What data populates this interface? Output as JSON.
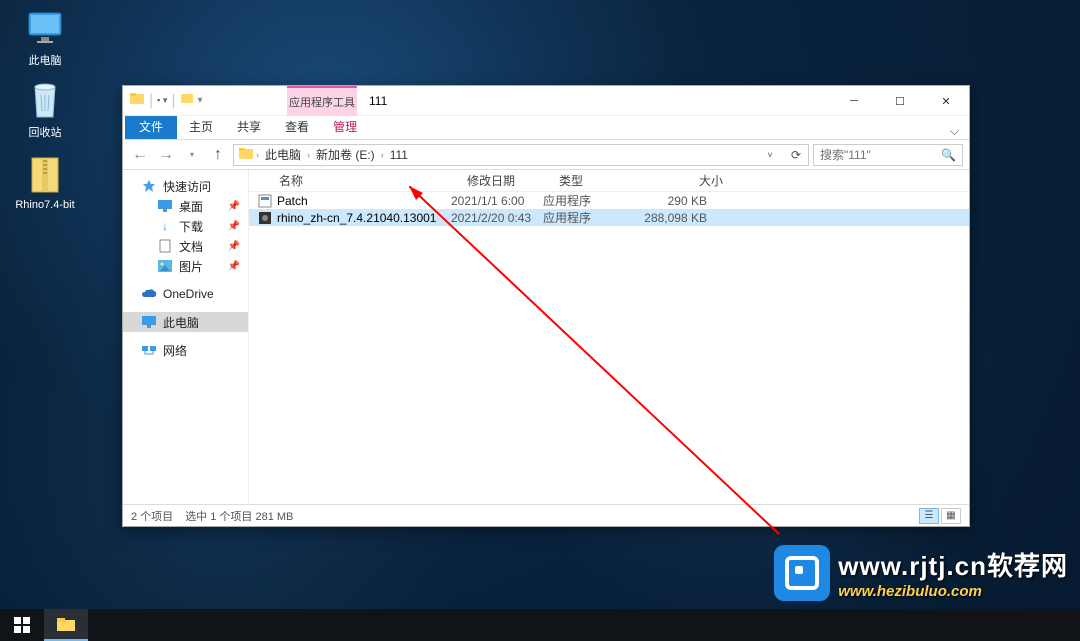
{
  "desktop": {
    "this_pc": "此电脑",
    "recycle_bin": "回收站",
    "zip_file": "Rhino7.4-bit"
  },
  "window": {
    "context_tab_label": "应用程序工具",
    "title": "111",
    "ribbon": {
      "file": "文件",
      "home": "主页",
      "share": "共享",
      "view": "查看",
      "manage": "管理"
    },
    "breadcrumb": {
      "c0": "此电脑",
      "c1": "新加卷 (E:)",
      "c2": "111"
    },
    "search_placeholder": "搜索\"111\"",
    "navpane": {
      "quick_access": "快速访问",
      "desktop": "桌面",
      "downloads": "下载",
      "documents": "文档",
      "pictures": "图片",
      "onedrive": "OneDrive",
      "this_pc": "此电脑",
      "network": "网络"
    },
    "columns": {
      "name": "名称",
      "date": "修改日期",
      "type": "类型",
      "size": "大小"
    },
    "files": {
      "0": {
        "name": "Patch",
        "date": "2021/1/1 6:00",
        "type": "应用程序",
        "size": "290 KB"
      },
      "1": {
        "name": "rhino_zh-cn_7.4.21040.13001",
        "date": "2021/2/20 0:43",
        "type": "应用程序",
        "size": "288,098 KB"
      }
    },
    "status": {
      "count": "2 个项目",
      "selection": "选中 1 个项目  281 MB"
    }
  },
  "watermark": {
    "line1": "www.rjtj.cn软荐网",
    "line2": "www.hezibuluo.com"
  }
}
